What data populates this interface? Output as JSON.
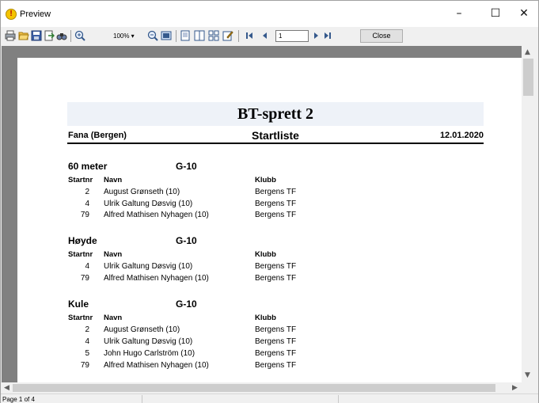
{
  "window": {
    "title": "Preview",
    "app_icon": "preview-app-icon",
    "minimize_glyph": "–",
    "maximize_glyph": "☐",
    "close_glyph": "✕"
  },
  "toolbar": {
    "zoom": "100% ▾",
    "page_value": "1",
    "close_label": "Close",
    "icons": [
      "print-icon",
      "open-icon",
      "save-icon",
      "export-icon",
      "find-icon",
      "zoom-in-icon",
      "zoom-out-icon",
      "whole-page-icon",
      "one-page-icon",
      "two-pages-icon",
      "multiple-pages-icon",
      "edit-page-icon",
      "first-page-icon",
      "prev-page-icon",
      "next-page-icon",
      "last-page-icon"
    ]
  },
  "report": {
    "title": "BT-sprett 2",
    "venue": "Fana (Bergen)",
    "list_title": "Startliste",
    "date": "12.01.2020",
    "columns": {
      "startnr": "Startnr",
      "name": "Navn",
      "club": "Klubb"
    },
    "sections": [
      {
        "event": "60 meter",
        "class": "G-10",
        "rows": [
          {
            "nr": "2",
            "name": "August Grønseth (10)",
            "club": "Bergens TF"
          },
          {
            "nr": "4",
            "name": "Ulrik Galtung Døsvig (10)",
            "club": "Bergens TF"
          },
          {
            "nr": "79",
            "name": "Alfred Mathisen Nyhagen (10)",
            "club": "Bergens TF"
          }
        ]
      },
      {
        "event": "Høyde",
        "class": "G-10",
        "rows": [
          {
            "nr": "4",
            "name": "Ulrik Galtung Døsvig (10)",
            "club": "Bergens TF"
          },
          {
            "nr": "79",
            "name": "Alfred Mathisen Nyhagen (10)",
            "club": "Bergens TF"
          }
        ]
      },
      {
        "event": "Kule",
        "class": "G-10",
        "rows": [
          {
            "nr": "2",
            "name": "August Grønseth (10)",
            "club": "Bergens TF"
          },
          {
            "nr": "4",
            "name": "Ulrik Galtung Døsvig (10)",
            "club": "Bergens TF"
          },
          {
            "nr": "5",
            "name": "John Hugo Carlström (10)",
            "club": "Bergens TF"
          },
          {
            "nr": "79",
            "name": "Alfred Mathisen Nyhagen (10)",
            "club": "Bergens TF"
          }
        ]
      }
    ]
  },
  "status": {
    "page_info": "Page 1 of 4"
  }
}
